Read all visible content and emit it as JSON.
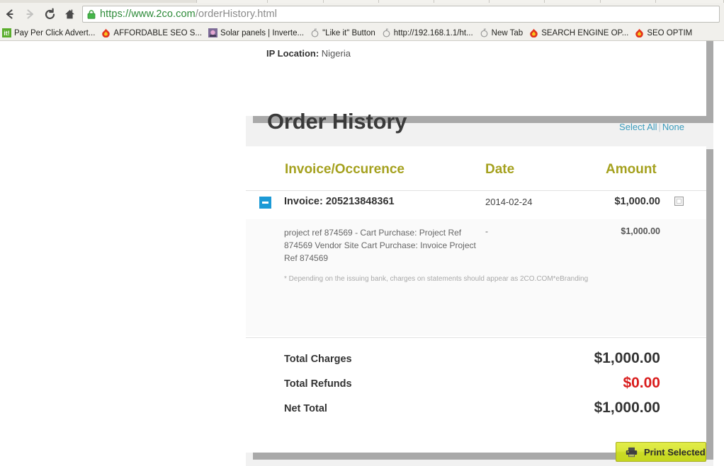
{
  "browser": {
    "nav": {
      "back": "back-arrow",
      "forward": "forward-arrow",
      "reload": "reload",
      "home": "home"
    },
    "omnibox": {
      "lock_icon": "lock-icon",
      "url_secure": "https://www.2co.com",
      "url_rest": "/orderHistory.html",
      "full_url": "https://www.2co.com/orderHistory.html"
    },
    "bookmarks": [
      {
        "label": "Pay Per Click Advert...",
        "icon": "green-it-favicon",
        "color": "#4c9a2a"
      },
      {
        "label": "AFFORDABLE SEO S...",
        "icon": "red-flame-favicon",
        "color": "#e02b1d"
      },
      {
        "label": "Solar panels | Inverte...",
        "icon": "purple-favicon",
        "color": "#9b59b6"
      },
      {
        "label": "\"Like it\" Button",
        "icon": "grey-globe-favicon",
        "color": "#9a9a9a"
      },
      {
        "label": "http://192.168.1.1/ht...",
        "icon": "grey-globe-favicon",
        "color": "#9a9a9a"
      },
      {
        "label": "New Tab",
        "icon": "grey-globe-favicon",
        "color": "#9a9a9a"
      },
      {
        "label": "SEARCH ENGINE OP...",
        "icon": "red-flame-favicon",
        "color": "#e02b1d"
      },
      {
        "label": "SEO OPTIM",
        "icon": "red-flame-favicon",
        "color": "#e02b1d"
      }
    ]
  },
  "page": {
    "ip_panel": {
      "label": "IP Location:",
      "value": "Nigeria"
    },
    "order_history": {
      "title": "Order History",
      "select_all": "Select All",
      "separator": "|",
      "none": "None",
      "columns": {
        "invoice": "Invoice/Occurence",
        "date": "Date",
        "amount": "Amount"
      },
      "rows": [
        {
          "toggle": "collapse-icon",
          "invoice_label": "Invoice: 205213848361",
          "date": "2014-02-24",
          "amount": "$1,000.00",
          "checked": false,
          "detail": {
            "description": "project ref 874569 - Cart Purchase: Project Ref 874569 Vendor Site Cart Purchase: Invoice Project Ref 874569",
            "date": "-",
            "amount": "$1,000.00"
          }
        }
      ],
      "footnote": "* Depending on the issuing bank, charges on statements should appear as 2CO.COM*eBranding",
      "totals": [
        {
          "label": "Total Charges",
          "value": "$1,000.00",
          "color": "#333333"
        },
        {
          "label": "Total Refunds",
          "value": "$0.00",
          "color": "#d91d1d"
        },
        {
          "label": "Net Total",
          "value": "$1,000.00",
          "color": "#333333"
        }
      ]
    },
    "print_button": {
      "label": "Print Selected",
      "icon": "printer-icon"
    }
  },
  "theme": {
    "header_olive": "#a5a11e",
    "link_blue": "#3b9cbd",
    "toggle_blue": "#1c9ad6",
    "refund_red": "#d91d1d",
    "button_green": "#cada26"
  }
}
